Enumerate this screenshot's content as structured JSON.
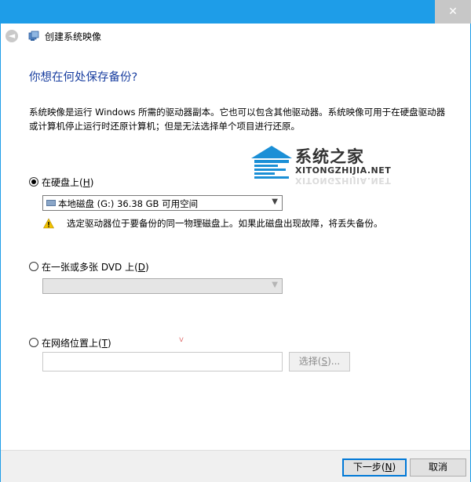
{
  "window": {
    "title": "创建系统映像",
    "close_glyph": "✕",
    "back_glyph": "◄"
  },
  "page": {
    "heading": "你想在何处保存备份?",
    "description": "系统映像是运行 Windows 所需的驱动器副本。它也可以包含其他驱动器。系统映像可用于在硬盘驱动器或计算机停止运行时还原计算机；但是无法选择单个项目进行还原。"
  },
  "watermark": {
    "brand": "系统之家",
    "url": "XITONGZHIJIA.NET"
  },
  "options": {
    "hard_disk": {
      "label_prefix": "在硬盘上(",
      "access_key": "H",
      "label_suffix": ")",
      "selected": true,
      "dropdown_value": "本地磁盘 (G:)  36.38 GB 可用空间",
      "warning": "选定驱动器位于要备份的同一物理磁盘上。如果此磁盘出现故障，将丢失备份。"
    },
    "dvd": {
      "label_prefix": "在一张或多张 DVD 上(",
      "access_key": "D",
      "label_suffix": ")",
      "selected": false,
      "dropdown_value": ""
    },
    "network": {
      "label_prefix": "在网络位置上(",
      "access_key": "T",
      "label_suffix": ")",
      "selected": false,
      "input_value": "",
      "browse_label_prefix": "选择(",
      "browse_access_key": "S",
      "browse_label_suffix": ")..."
    }
  },
  "footer": {
    "next_prefix": "下一步(",
    "next_key": "N",
    "next_suffix": ")",
    "cancel": "取消"
  },
  "stray_mark": "v",
  "colors": {
    "titlebar": "#1e9de8",
    "heading": "#1a3fa0",
    "warning": "#f2c200",
    "watermark_blue": "#1b8fd6"
  }
}
